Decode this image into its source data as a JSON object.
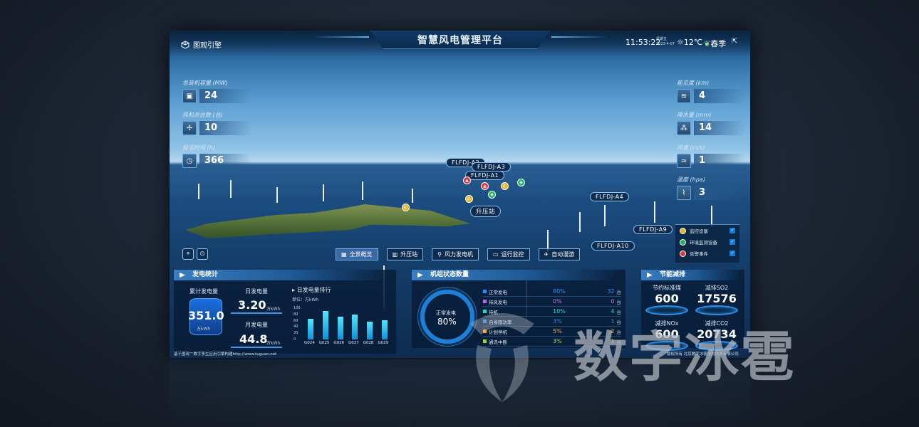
{
  "app": {
    "title": "智慧风电管理平台",
    "logo_text": "图观引擎",
    "time": "11:53:22",
    "weekday": "星期五",
    "date": "2023-4-07",
    "weather": "12℃",
    "season": "春季"
  },
  "left_stats": [
    {
      "label": "总装机容量 (MW)",
      "value": "24",
      "icon": "chip-icon"
    },
    {
      "label": "风机总台数 (台)",
      "value": "10",
      "icon": "wind-turbine-icon"
    },
    {
      "label": "投运时间 (h)",
      "value": "366",
      "icon": "clock-icon"
    }
  ],
  "right_stats": [
    {
      "label": "能见度 (km)",
      "value": "4",
      "icon": "visibility-icon"
    },
    {
      "label": "降水量 (mm)",
      "value": "14",
      "icon": "rain-icon"
    },
    {
      "label": "风速 (m/s)",
      "value": "1",
      "icon": "wind-icon"
    },
    {
      "label": "温度 (hpa)",
      "value": "3",
      "icon": "thermometer-icon"
    }
  ],
  "turbine_labels": [
    "FLFDJ-A2",
    "FLFDJ-A3",
    "FLFDJ-A1",
    "FLFDJ-A4",
    "FLFDJ-A9",
    "FLFDJ-A10"
  ],
  "station_label": "升压站",
  "nav": [
    {
      "label": "全景概览",
      "icon": "grid-icon"
    },
    {
      "label": "升压站",
      "icon": "chart-icon"
    },
    {
      "label": "风力发电机",
      "icon": "turbine-icon"
    },
    {
      "label": "运行监控",
      "icon": "monitor-icon"
    },
    {
      "label": "自动漫游",
      "icon": "plane-icon"
    }
  ],
  "legend": [
    {
      "label": "监控设备",
      "color": "#e7b21e"
    },
    {
      "label": "环境监测设备",
      "color": "#21b55a"
    },
    {
      "label": "告警事件",
      "color": "#d9393b"
    }
  ],
  "power_panel": {
    "title": "发电统计",
    "total_label": "累计发电量",
    "total_value": "351.0",
    "total_unit": "万kWh",
    "daily_label": "日发电量",
    "daily_value": "3.20",
    "daily_unit": "万kWh",
    "monthly_label": "月发电量",
    "monthly_value": "44.8",
    "monthly_unit": "万kWh",
    "rank_title": "日发电量排行",
    "rank_unit": "单位：万kWh"
  },
  "chart_data": {
    "type": "bar",
    "title": "日发电量排行",
    "categories": [
      "G024",
      "G025",
      "G026",
      "G027",
      "G028",
      "G029"
    ],
    "values": [
      65,
      90,
      72,
      80,
      57,
      62
    ],
    "ylim": [
      0,
      100
    ],
    "yticks": [
      "100",
      "80",
      "60",
      "40",
      "20",
      "0"
    ]
  },
  "unit_panel": {
    "title": "机组状态数量",
    "ring_label": "正常发电",
    "ring_value": "80%",
    "rows": [
      {
        "label": "正常发电",
        "pct": "80%",
        "count": "32",
        "unit": "台",
        "color": "#2f8ff0"
      },
      {
        "label": "待风发电",
        "pct": "0%",
        "count": "0",
        "unit": "台",
        "color": "#b86de0"
      },
      {
        "label": "待机",
        "pct": "10%",
        "count": "4",
        "unit": "台",
        "color": "#2fd3c6"
      },
      {
        "label": "自身限功率",
        "pct": "3%",
        "count": "1",
        "unit": "台",
        "color": "#3a7fe0"
      },
      {
        "label": "计划停机",
        "pct": "5%",
        "count": "2",
        "unit": "台",
        "color": "#f2a33a"
      },
      {
        "label": "通讯中断",
        "pct": "3%",
        "count": "1",
        "unit": "台",
        "color": "#9bd63a"
      }
    ]
  },
  "energy_panel": {
    "title": "节能减排",
    "items": [
      {
        "label": "节约标准煤",
        "value": "600"
      },
      {
        "label": "减排SO2",
        "value": "17576"
      },
      {
        "label": "减排NOx",
        "value": "600"
      },
      {
        "label": "减排CO2",
        "value": "20734"
      }
    ]
  },
  "footer": {
    "left": "基于图观™数字孪生应用引擎构建http://www.tuguan.net",
    "right": "版权所有 北京数字冰雹信息技术有限公司"
  },
  "watermark": "数字冰雹"
}
